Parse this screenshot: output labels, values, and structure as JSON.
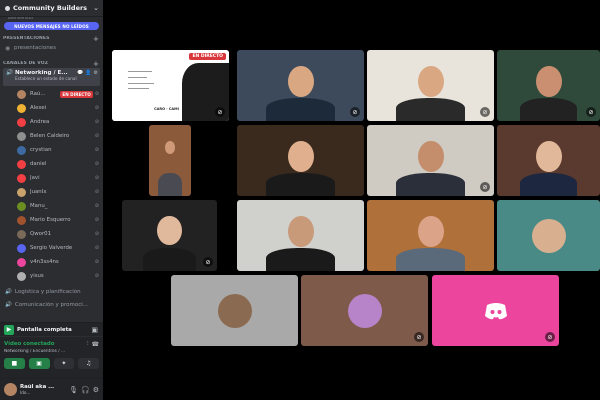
{
  "server": {
    "name": "Community Builders"
  },
  "cut_channel": "bienvenida",
  "unread_pill": "NUEVOS MENSAJES NO LEÍDOS",
  "categories": {
    "presentaciones": "PRESENTACIONES",
    "voice": "CANALES DE VOZ"
  },
  "text_channels": [
    {
      "label": "presentaciones"
    }
  ],
  "active_channel": {
    "name": "Networking / E...",
    "status": "Establece un estado de canal"
  },
  "members": [
    {
      "name": "Raú...",
      "live": "EN DIRECTO",
      "color": "#b58563"
    },
    {
      "name": "Alexei",
      "color": "#f0b232"
    },
    {
      "name": "Andrea",
      "color": "#f23f43"
    },
    {
      "name": "Belen Caldeiro",
      "color": "#8f8f8f"
    },
    {
      "name": "crystian",
      "color": "#3e6aa3"
    },
    {
      "name": "daniel",
      "color": "#f23f43"
    },
    {
      "name": "Javi",
      "color": "#f23f43"
    },
    {
      "name": "JuanIx",
      "color": "#c9a36b"
    },
    {
      "name": "Manu_",
      "color": "#6b8e23"
    },
    {
      "name": "Mario Esquerro",
      "color": "#a0522d"
    },
    {
      "name": "Qwor01",
      "color": "#7a6a5a"
    },
    {
      "name": "Sergio Valverde",
      "color": "#5865f2"
    },
    {
      "name": "v4n3ss4ns",
      "color": "#eb459e"
    },
    {
      "name": "yisus",
      "color": "#b0b0b0"
    }
  ],
  "other_voice_channels": [
    {
      "label": "Logística y planificación"
    },
    {
      "label": "Comunicación y promoci..."
    }
  ],
  "screen_share": {
    "label": "Pantalla completa"
  },
  "voice_status": {
    "title": "Vídeo conectado",
    "subtitle": "Networking / Encuentros / ..."
  },
  "user": {
    "name": "Raúl aka ...",
    "status": "Ido..."
  },
  "tiles": [
    {
      "bg": "#ffffff",
      "live": "EN DIRECTO",
      "slide_title": "CARO · CAMI",
      "mic_off": true
    },
    {
      "bg": "#3d4a5c",
      "skin": "#d9a882",
      "shirt": "#1d2a3a",
      "mic_off": true
    },
    {
      "bg": "#e8e4dc",
      "skin": "#d9a882",
      "shirt": "#2a2a2a",
      "mic_off": true
    },
    {
      "bg": "#2f4a3a",
      "skin": "#c98f70",
      "shirt": "#222222",
      "mic_off": true
    },
    {
      "bg": "#8a5a3a",
      "skin": "#d09a78",
      "shirt": "#4a4a52",
      "mic_off": false
    },
    {
      "bg": "#3a2a1e",
      "skin": "#e0b08e",
      "shirt": "#1a1a1a",
      "mic_off": false
    },
    {
      "bg": "#cfcac2",
      "skin": "#c48e6c",
      "shirt": "#2a2f3a",
      "mic_off": true
    },
    {
      "bg": "#5a3a2e",
      "skin": "#e2b89a",
      "shirt": "#1e2740",
      "mic_off": false
    },
    {
      "bg": "#222222",
      "skin": "#e0b89c",
      "shirt": "#1a1a1a",
      "mic_off": true
    },
    {
      "bg": "#d0d0cc",
      "skin": "#c99a7a",
      "shirt": "#1a1a1a",
      "mic_off": false
    },
    {
      "bg": "#b0703a",
      "skin": "#dba488",
      "shirt": "#5a6a7a",
      "mic_off": false
    },
    {
      "bg": "#4a8a86",
      "avatar": "#d8b090",
      "mic_off": false
    },
    {
      "bg": "#a9a9a9",
      "avatar": "#8a6a50",
      "mic_off": false
    },
    {
      "bg": "#7d5a4a",
      "avatar": "#b784c9",
      "mic_off": true
    },
    {
      "bg": "#eb459e",
      "discord_icon": "discord-logo",
      "mic_off": true
    }
  ]
}
